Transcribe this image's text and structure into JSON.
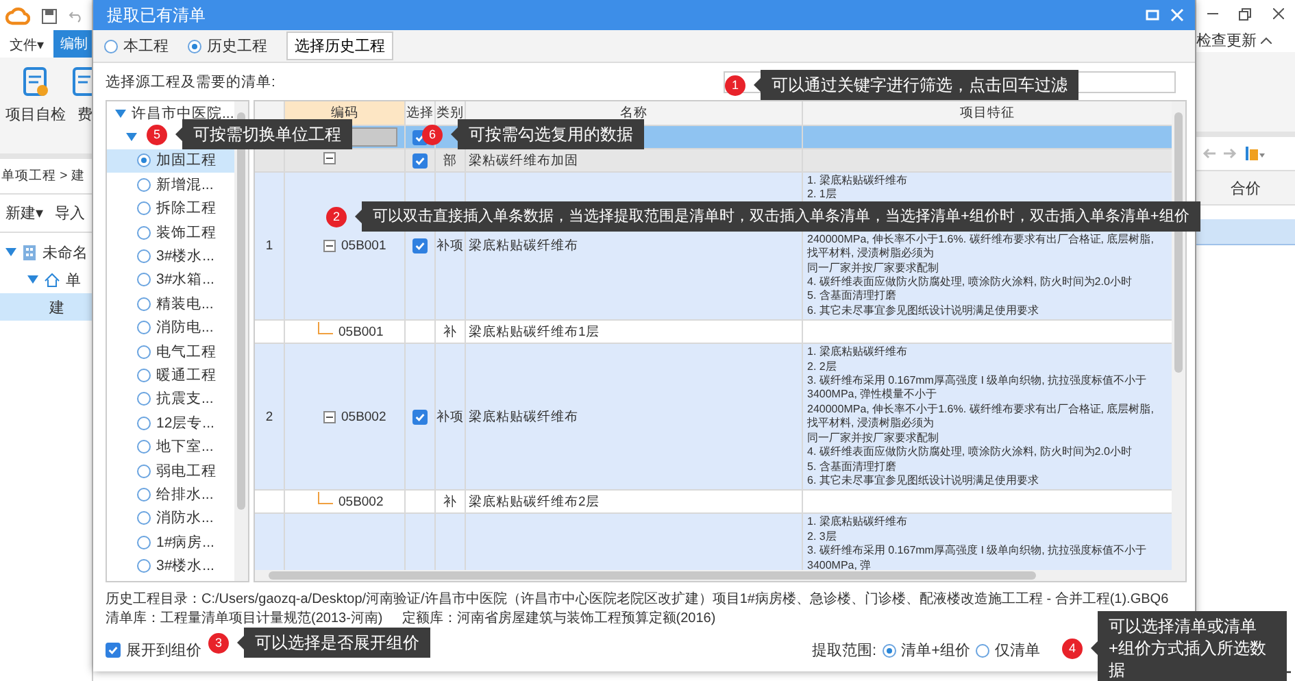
{
  "app": {
    "menu": [
      {
        "label": "文件▾",
        "selected": false
      },
      {
        "label": "编制",
        "selected": true
      }
    ],
    "ribbon": [
      {
        "label": "项目自检"
      },
      {
        "label": "费"
      }
    ],
    "breadcrumb": "单项工程 > 建",
    "toolbar": [
      "新建▾",
      "导入"
    ],
    "tree": [
      {
        "label": "未命名",
        "expanded": true,
        "selected": false,
        "children": [
          {
            "label": "单",
            "expanded": true,
            "selected": false,
            "children": [
              {
                "label": "建",
                "selected": true
              }
            ]
          }
        ]
      }
    ],
    "update_label": "检查更新",
    "grid_header": "合价"
  },
  "dialog": {
    "title": "提取已有清单",
    "source": [
      {
        "label": "本工程",
        "selected": false
      },
      {
        "label": "历史工程",
        "selected": true
      }
    ],
    "pick_button": "选择历史工程",
    "list_label": "选择源工程及需要的清单:",
    "project_tree": {
      "label": "许昌市中医院...",
      "expanded": true,
      "children": [
        {
          "expanded": true,
          "items": [
            {
              "label": "加固工程",
              "selected": true
            },
            {
              "label": "新增混...",
              "selected": false
            },
            {
              "label": "拆除工程",
              "selected": false
            },
            {
              "label": "装饰工程",
              "selected": false
            },
            {
              "label": "3#楼水...",
              "selected": false
            },
            {
              "label": "3#水箱...",
              "selected": false
            },
            {
              "label": "精装电...",
              "selected": false
            },
            {
              "label": "消防电...",
              "selected": false
            },
            {
              "label": "电气工程",
              "selected": false
            },
            {
              "label": "暖通工程",
              "selected": false
            },
            {
              "label": "抗震支...",
              "selected": false
            },
            {
              "label": "12层专...",
              "selected": false
            },
            {
              "label": "地下室...",
              "selected": false
            },
            {
              "label": "弱电工程",
              "selected": false
            },
            {
              "label": "给排水...",
              "selected": false
            },
            {
              "label": "消防水...",
              "selected": false
            },
            {
              "label": "1#病房...",
              "selected": false
            },
            {
              "label": "3#楼水...",
              "selected": false
            }
          ]
        }
      ]
    },
    "columns": [
      "编码",
      "选择",
      "类别",
      "名称",
      "项目特征"
    ],
    "rows": [
      {
        "kind": "project",
        "selected": true,
        "checked": true
      },
      {
        "kind": "division",
        "selected": false,
        "checked": true,
        "expanded": true,
        "type": "部",
        "name": "梁粘碳纤维布加固"
      },
      {
        "kind": "item",
        "selected": false,
        "number": "1",
        "code": "05B001",
        "checked": true,
        "expanded": true,
        "type": "补项",
        "name": "梁底粘贴碳纤维布",
        "callout_over_features": true,
        "features": [
          "1. 梁底粘贴碳纤维布",
          "2. 1层",
          "240000MPa, 伸长率不小于1.6%. 碳纤维布要求有出厂合格证, 底层树脂, 找平材料, 浸渍树脂必须为",
          "同一厂家并按厂家要求配制",
          "4. 碳纤维表面应做防火防腐处理, 喷涂防火涂料, 防火时间为2.0小时",
          "5. 含基面清理打磨",
          "6. 其它未尽事宜参见图纸设计说明满足使用要求"
        ]
      },
      {
        "kind": "sub",
        "selected": false,
        "code": "05B001",
        "type": "补",
        "name": "梁底粘贴碳纤维布1层"
      },
      {
        "kind": "item",
        "selected": false,
        "number": "2",
        "code": "05B002",
        "checked": true,
        "expanded": true,
        "type": "补项",
        "name": "梁底粘贴碳纤维布",
        "callout_over_features": false,
        "features": [
          "1. 梁底粘贴碳纤维布",
          "2. 2层",
          "3. 碳纤维布采用 0.167mm厚高强度 I 级单向织物, 抗拉强度标值不小于3400MPa, 弹性模量不小于",
          "240000MPa, 伸长率不小于1.6%. 碳纤维布要求有出厂合格证, 底层树脂, 找平材料, 浸渍树脂必须为",
          "同一厂家并按厂家要求配制",
          "4. 碳纤维表面应做防火防腐处理, 喷涂防火涂料, 防火时间为2.0小时",
          "5. 含基面清理打磨",
          "6. 其它未尽事宜参见图纸设计说明满足使用要求"
        ]
      },
      {
        "kind": "sub",
        "selected": false,
        "code": "05B002",
        "type": "补",
        "name": "梁底粘贴碳纤维布2层"
      },
      {
        "kind": "item",
        "selected": false,
        "callout_over_features": false,
        "features": [
          "1. 梁底粘贴碳纤维布",
          "2. 3层",
          "3. 碳纤维布采用 0.167mm厚高强度 I 级单向织物, 抗拉强度标值不小于3400MPa, 弹"
        ]
      }
    ],
    "info": [
      "历史工程目录：C:/Users/gaozq-a/Desktop/河南验证/许昌市中医院（许昌市中心医院老院区改扩建）项目1#病房楼、急诊楼、门诊楼、配液楼改造施工工程 - 合并工程(1).GBQ6",
      "清单库：工程量清单项目计量规范(2013-河南)",
      "定额库：河南省房屋建筑与装饰工程预算定额(2016)"
    ],
    "expand_option": {
      "label": "展开到组价",
      "checked": true
    },
    "scope_label": "提取范围:",
    "scope": [
      {
        "label": "清单+组价",
        "selected": true
      },
      {
        "label": "仅清单",
        "selected": false
      }
    ]
  },
  "callouts": [
    {
      "number": "1",
      "text": "可以通过关键字进行筛选，点击回车过滤"
    },
    {
      "number": "5",
      "text": "可按需切换单位工程"
    },
    {
      "number": "6",
      "text": "可按需勾选复用的数据"
    },
    {
      "number": "2",
      "text": "可以双击直接插入单条数据，当选择提取范围是清单时，双击插入单条清单，当选择清单+组价时，双击插入单条清单+组价"
    },
    {
      "number": "3",
      "text": "可以选择是否展开组价"
    },
    {
      "number": "4",
      "text": "可以选择清单或清单+组价方式插入所选数据"
    }
  ]
}
